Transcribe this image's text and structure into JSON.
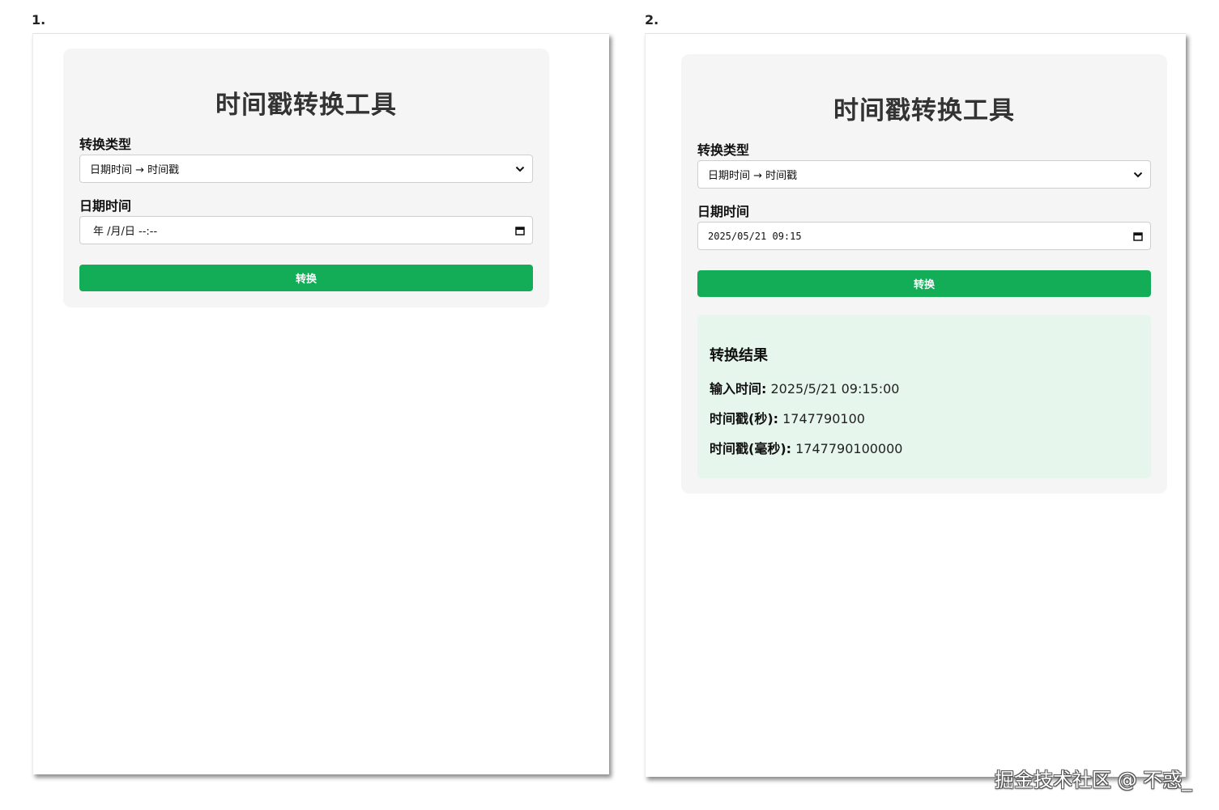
{
  "panels": [
    {
      "step": "1.",
      "title": "时间戳转换工具",
      "type_label": "转换类型",
      "select_value": "日期时间 → 时间戳",
      "datetime_label": "日期时间",
      "datetime_value": "年 /月/日 --:--",
      "button_label": "转换"
    },
    {
      "step": "2.",
      "title": "时间戳转换工具",
      "type_label": "转换类型",
      "select_value": "日期时间 → 时间戳",
      "datetime_label": "日期时间",
      "datetime_value": "2025/05/21 09:15",
      "button_label": "转换",
      "result": {
        "title": "转换结果",
        "input_label": "输入时间:",
        "input_value": "2025/5/21 09:15:00",
        "sec_label": "时间戳(秒):",
        "sec_value": "1747790100",
        "ms_label": "时间戳(毫秒):",
        "ms_value": "1747790100000"
      }
    }
  ],
  "icons": {
    "dropdown": "chevron-down-icon",
    "calendar": "calendar-icon"
  },
  "colors": {
    "button": "#13ad57",
    "result_bg": "#e7f6ed",
    "card_bg": "#f5f5f5"
  },
  "watermark": "掘金技术社区 @ 不惑_"
}
